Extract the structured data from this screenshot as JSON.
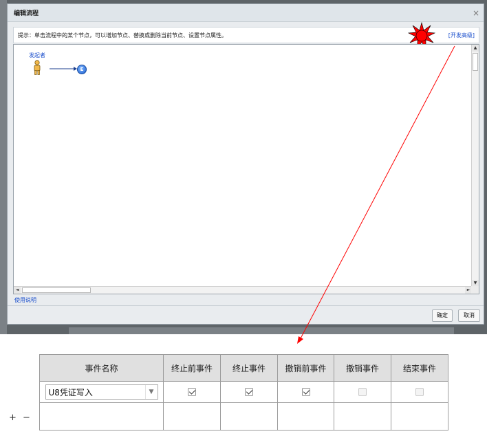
{
  "dialog": {
    "title": "编辑流程",
    "close_label": "×",
    "hint": "提示：单击流程中的某个节点，可以增加节点、替换或删除当前节点、设置节点属性。",
    "advanced_link": "[开发高级]",
    "usage_link": "使用说明",
    "ok_label": "确定",
    "cancel_label": "取消"
  },
  "flow": {
    "start_label": "发起者",
    "end_label": "E"
  },
  "scrollbar": {
    "up": "▲",
    "down": "▼",
    "left": "◄",
    "right": "►"
  },
  "event_table": {
    "headers": [
      "事件名称",
      "终止前事件",
      "终止事件",
      "撤销前事件",
      "撤销事件",
      "结束事件"
    ],
    "rows": [
      {
        "event_name": "U8凭证写入",
        "checks": [
          true,
          true,
          true,
          false,
          false
        ]
      }
    ],
    "select_arrow": "▼"
  },
  "row_controls": {
    "add_label": "+",
    "remove_label": "−"
  },
  "colors": {
    "highlight_red": "#ff0000",
    "link_blue": "#1b4fcc",
    "header_gray": "#e0e0e0"
  }
}
